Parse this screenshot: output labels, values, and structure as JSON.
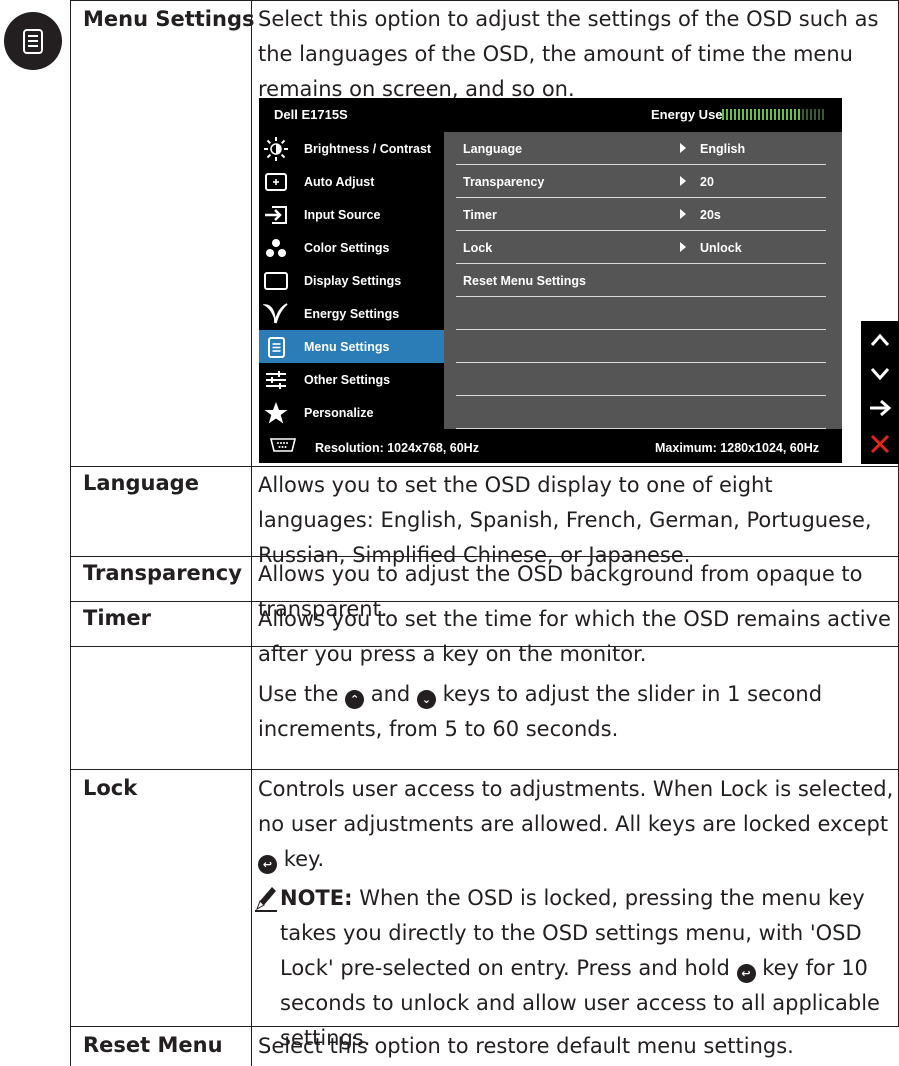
{
  "rows": [
    {
      "label": "Menu Settings",
      "description": "Select this option to adjust the settings of the OSD such as the languages of the OSD, the amount of time the menu remains on screen, and so on."
    },
    {
      "label": "Language",
      "description": "Allows you to set the OSD display to one of eight languages: English, Spanish, French, German, Portuguese, Russian, Simplified Chinese, or Japanese."
    },
    {
      "label": "Transparency",
      "description": "Allows you to adjust the OSD background from opaque to transparent."
    },
    {
      "label": "Timer",
      "description": "Allows you to set the time for which the OSD remains active after you press a key on the monitor.",
      "extra_prefix": "Use the",
      "extra_mid": "and",
      "extra_suffix": "keys to adjust the slider in 1 second increments, from 5 to 60 seconds."
    },
    {
      "label": "Lock",
      "description_prefix": "Controls user access to adjustments. When Lock is selected, no user adjustments are allowed. All keys are locked except",
      "description_suffix": "key.",
      "note_label": "NOTE:",
      "note_prefix": "When the OSD is locked, pressing the menu key takes you directly to the OSD settings menu, with 'OSD Lock' pre-selected on entry. Press and hold",
      "note_suffix": "key for 10 seconds to unlock and allow user access to all applicable settings."
    },
    {
      "label": "Reset Menu Settings",
      "description": "Select this option to restore default menu settings."
    }
  ],
  "osd": {
    "model": "Dell E1715S",
    "energy_label": "Energy Use",
    "energy_level": 0.77,
    "menu": [
      {
        "label": "Brightness / Contrast",
        "icon": "brightness-icon"
      },
      {
        "label": "Auto Adjust",
        "icon": "auto-adjust-icon"
      },
      {
        "label": "Input Source",
        "icon": "input-source-icon"
      },
      {
        "label": "Color Settings",
        "icon": "color-settings-icon"
      },
      {
        "label": "Display Settings",
        "icon": "display-settings-icon"
      },
      {
        "label": "Energy Settings",
        "icon": "energy-settings-icon"
      },
      {
        "label": "Menu Settings",
        "icon": "menu-settings-icon",
        "selected": true
      },
      {
        "label": "Other Settings",
        "icon": "other-settings-icon"
      },
      {
        "label": "Personalize",
        "icon": "star-icon"
      }
    ],
    "options": [
      {
        "name": "Language",
        "value": "English"
      },
      {
        "name": "Transparency",
        "value": "20"
      },
      {
        "name": "Timer",
        "value": "20s"
      },
      {
        "name": "Lock",
        "value": "Unlock"
      },
      {
        "name": "Reset Menu Settings",
        "value": ""
      }
    ],
    "resolution": "Resolution: 1024x768, 60Hz",
    "maximum": "Maximum: 1280x1024, 60Hz"
  },
  "buttons": [
    "up-arrow-icon",
    "down-arrow-icon",
    "right-arrow-icon",
    "close-x-icon"
  ],
  "colors": {
    "osd_selected": "#2a7db6",
    "osd_panel": "#555555",
    "energy_meter": "#62c24a",
    "exit_red": "#e0261b"
  }
}
